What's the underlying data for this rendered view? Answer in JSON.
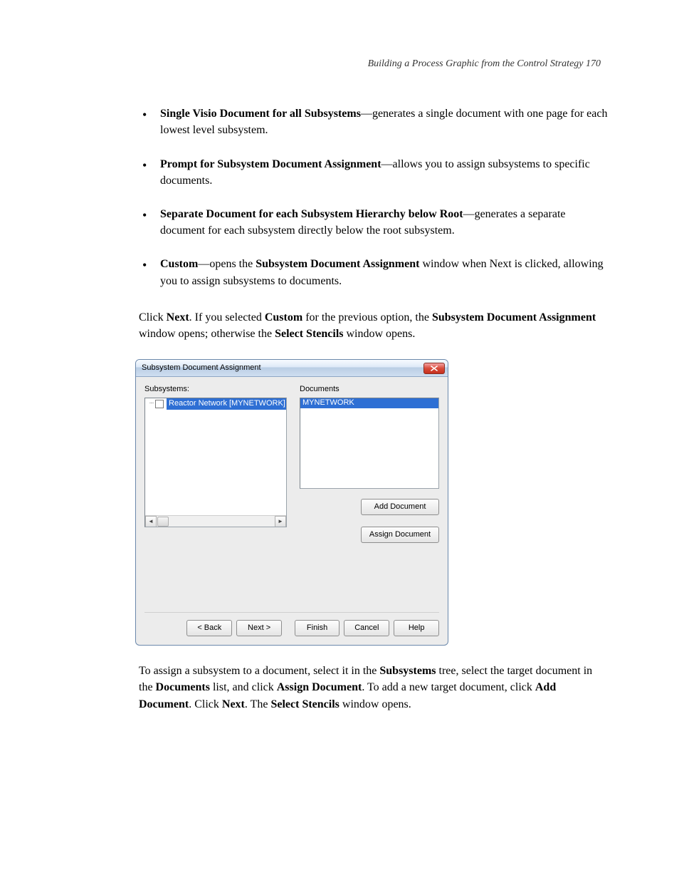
{
  "header": {
    "line": "Building a Process Graphic from the Control Strategy 170"
  },
  "options": [
    {
      "prefix_bold": "Single Visio Document for all Subsystems",
      "middle": "—generates a single document with one page for each lowest level subsystem.",
      "suffix_bold": ""
    },
    {
      "prefix_bold": "Prompt for Subsystem Document Assignment",
      "middle": "—allows you to assign subsystems to specific documents.",
      "suffix_bold": ""
    },
    {
      "prefix_bold": "Separate Document for each Subsystem Hierarchy below Root",
      "middle": "—generates a separate document for each subsystem directly below the root subsystem.",
      "suffix_bold": ""
    },
    {
      "prefix_bold": "Custom",
      "middle": "—opens the ",
      "suffix_bold": "Subsystem Document Assignment",
      "tail": " window when Next is clicked, allowing you to assign subsystems to documents."
    }
  ],
  "para1": {
    "p1": "Click ",
    "b1": "Next",
    "p2": ". If you selected ",
    "b2": "Custom",
    "p3": " for the previous option, the ",
    "b3": "Subsystem Document Assignment",
    "p4": " window opens; otherwise the ",
    "b4": "Select Stencils",
    "p5": " window opens."
  },
  "dialog": {
    "title": "Subsystem Document Assignment",
    "subsystems_label": "Subsystems:",
    "documents_label": "Documents",
    "tree_item": "Reactor Network [MYNETWORK]",
    "list_item": "MYNETWORK",
    "buttons": {
      "add_document": "Add Document",
      "assign_document": "Assign Document",
      "back": "< Back",
      "next": "Next >",
      "finish": "Finish",
      "cancel": "Cancel",
      "help": "Help"
    }
  },
  "para2": {
    "p1": "To assign a subsystem to a document, select it in the ",
    "b1": "Subsystems",
    "p2": " tree, select the target document in the ",
    "b2": "Documents",
    "p3": " list, and click ",
    "b3": "Assign Document",
    "p4": ". To add a new target document, click ",
    "b4": "Add Document",
    "p5": ". Click ",
    "b5": "Next",
    "p6": ". The ",
    "b6": "Select Stencils",
    "p7": " window opens."
  }
}
